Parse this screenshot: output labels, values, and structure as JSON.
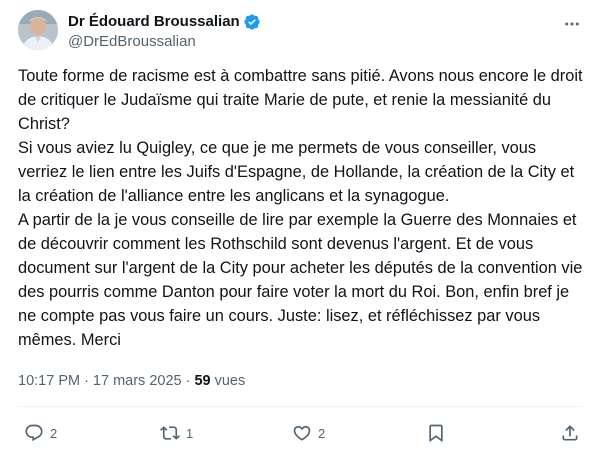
{
  "author": {
    "display_name": "Dr Édouard Broussalian",
    "handle": "@DrEdBroussalian",
    "verified": true,
    "verified_color": "#1d9bf0"
  },
  "tweet": {
    "text": "Toute forme de racisme est à combattre sans pitié. Avons nous encore le droit de critiquer le Judaïsme qui traite Marie de pute, et renie la messianité du Christ?\nSi vous aviez lu Quigley, ce que je me permets de vous conseiller, vous verriez le lien entre les Juifs d'Espagne, de Hollande, la création de la City et la création de l'alliance entre les anglicans et la synagogue.\nA partir de la je vous conseille de lire par exemple la Guerre des Monnaies et de découvrir comment les Rothschild sont devenus l'argent. Et de vous document sur l'argent de la City pour acheter les députés de la convention vie des pourris comme Danton pour faire voter la mort du Roi. Bon, enfin bref je ne compte pas vous faire un cours. Juste: lisez, et réfléchissez par vous mêmes. Merci"
  },
  "meta": {
    "time": "10:17 PM",
    "separator": "·",
    "date": "17 mars 2025",
    "views_count": "59",
    "views_label": "vues"
  },
  "actions": {
    "replies": "2",
    "reposts": "1",
    "likes": "2"
  },
  "icons": {
    "more": "more-horizontal-icon",
    "reply": "reply-icon",
    "repost": "repost-icon",
    "like": "heart-icon",
    "bookmark": "bookmark-icon",
    "share": "share-icon"
  },
  "colors": {
    "text_primary": "#0f1419",
    "text_secondary": "#536471",
    "divider": "#eff3f4"
  }
}
